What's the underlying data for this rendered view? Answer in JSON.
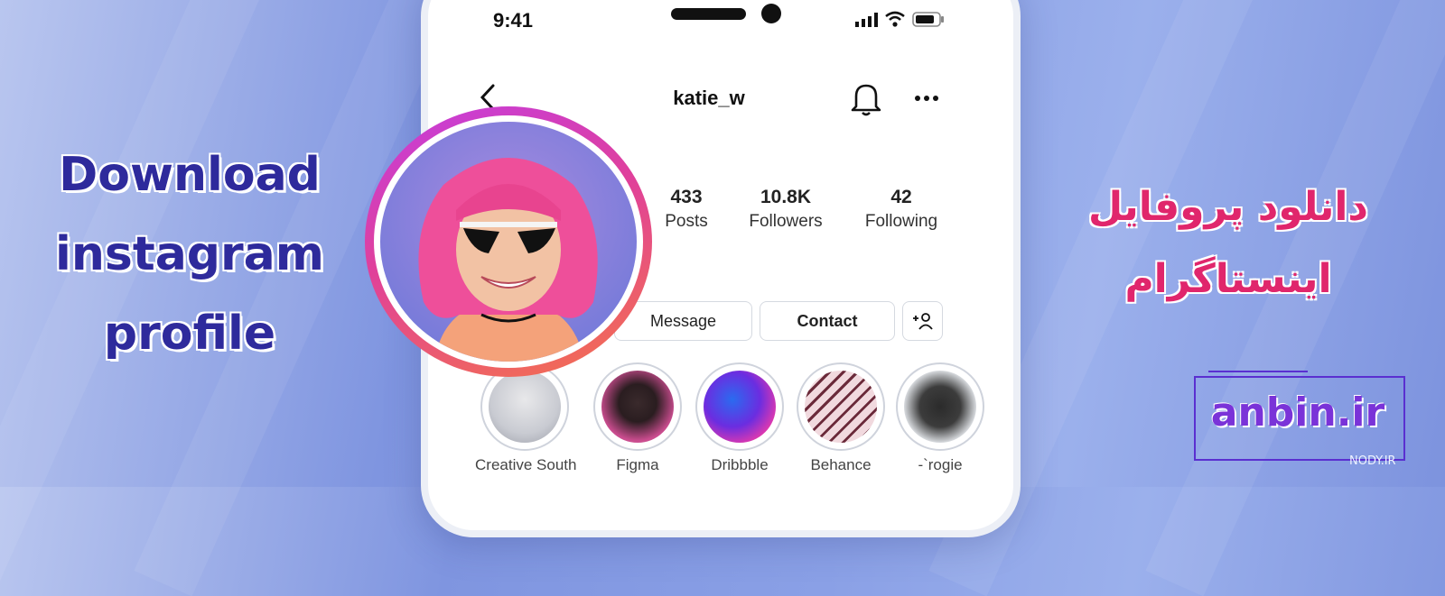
{
  "banner": {
    "title_en_line1": "Download",
    "title_en_line2": "instagram",
    "title_en_line3": "profile",
    "title_fa_line1": "دانلود پروفایل",
    "title_fa_line2": "اینستاگرام",
    "brand": "anbin.ir",
    "watermark": "NODY.IR"
  },
  "status_bar": {
    "time": "9:41"
  },
  "profile": {
    "username": "katie_w",
    "stats": [
      {
        "value": "433",
        "label": "Posts"
      },
      {
        "value": "10.8K",
        "label": "Followers"
      },
      {
        "value": "42",
        "label": "Following"
      }
    ],
    "buttons": {
      "message": "Message",
      "contact": "Contact"
    }
  },
  "highlights": [
    {
      "label": "Creative South"
    },
    {
      "label": "Figma"
    },
    {
      "label": "Dribbble"
    },
    {
      "label": "Behance"
    },
    {
      "label": "-`rogie"
    }
  ],
  "colors": {
    "title_en": "#2e2a9c",
    "title_fa": "#e0266c",
    "brand": "#7a33d8",
    "story_ring": "#c43de0"
  }
}
